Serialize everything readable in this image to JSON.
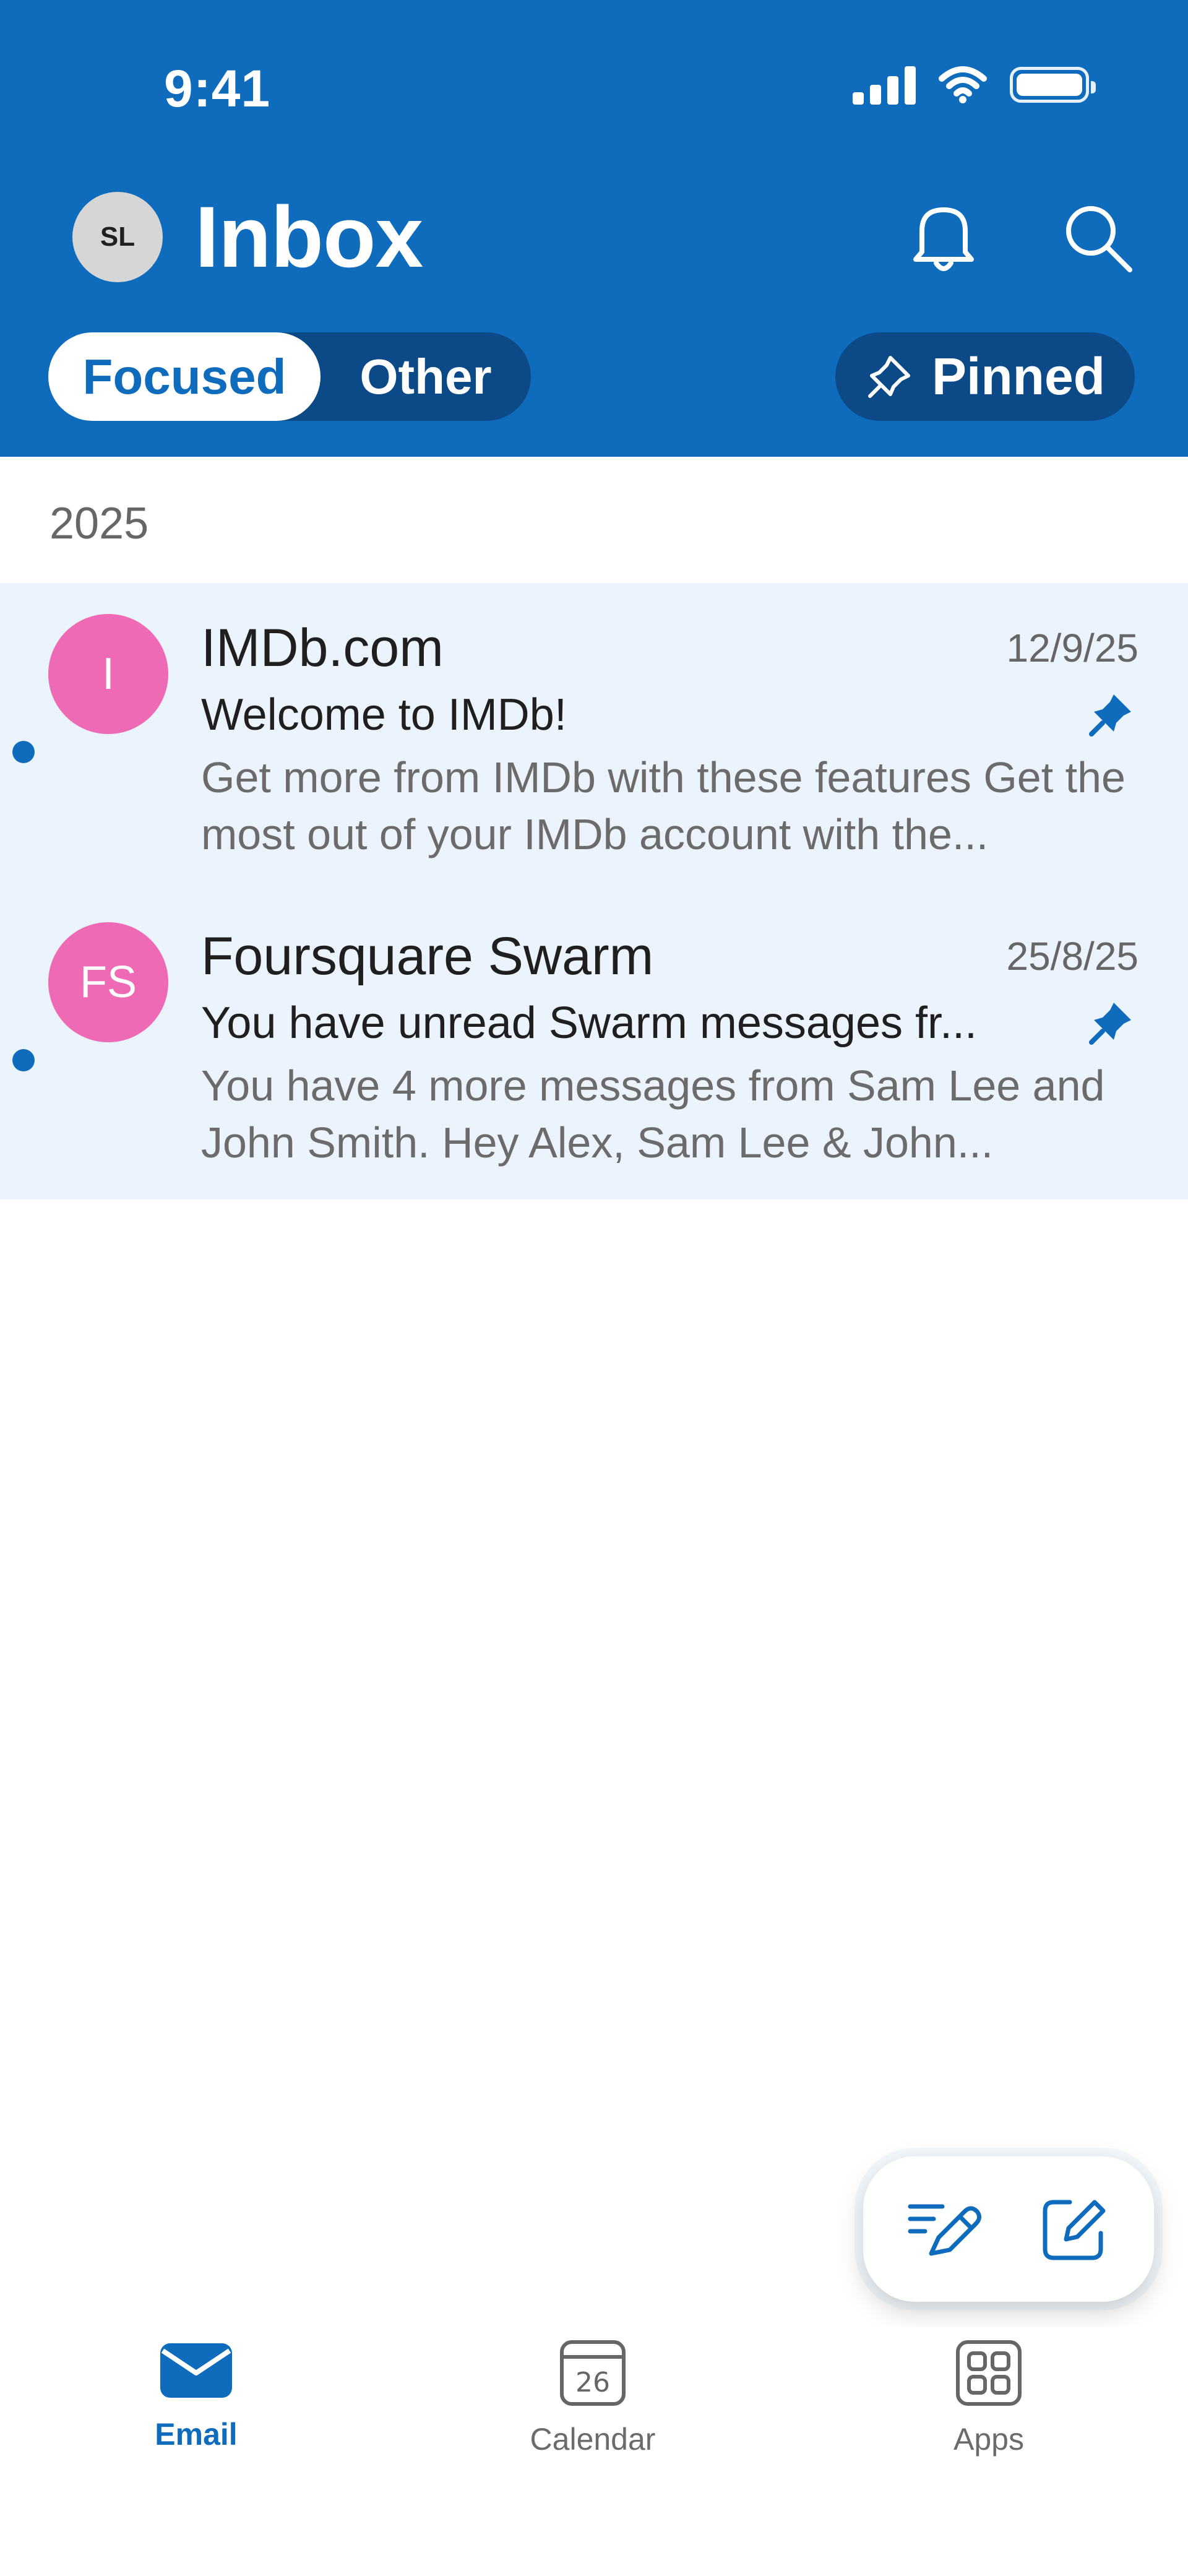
{
  "status_bar": {
    "time": "9:41"
  },
  "header": {
    "avatar_initials": "SL",
    "title": "Inbox",
    "notification_icon": "bell-icon",
    "search_icon": "search-icon",
    "tabs": {
      "focused": "Focused",
      "other": "Other"
    },
    "pinned_label": "Pinned",
    "accent_color": "#0f6cbd"
  },
  "section": {
    "year": "2025"
  },
  "emails": [
    {
      "avatar_initials": "I",
      "sender": "IMDb.com",
      "date": "12/9/25",
      "subject": "Welcome to IMDb!",
      "preview": "Get more from IMDb with these features Get the most out of your IMDb account with the...",
      "avatar_color": "#ef6ab5"
    },
    {
      "avatar_initials": "FS",
      "sender": "Foursquare Swarm",
      "date": "25/8/25",
      "subject": "You have unread Swarm messages fr...",
      "preview": "You have 4 more messages from Sam Lee and John Smith. Hey Alex, Sam Lee & John...",
      "avatar_color": "#ef6ab5"
    }
  ],
  "fab": {
    "copilot_icon": "pen-lines-icon",
    "compose_icon": "compose-icon"
  },
  "bottom_nav": {
    "email": "Email",
    "calendar": "Calendar",
    "calendar_day": "26",
    "apps": "Apps"
  }
}
